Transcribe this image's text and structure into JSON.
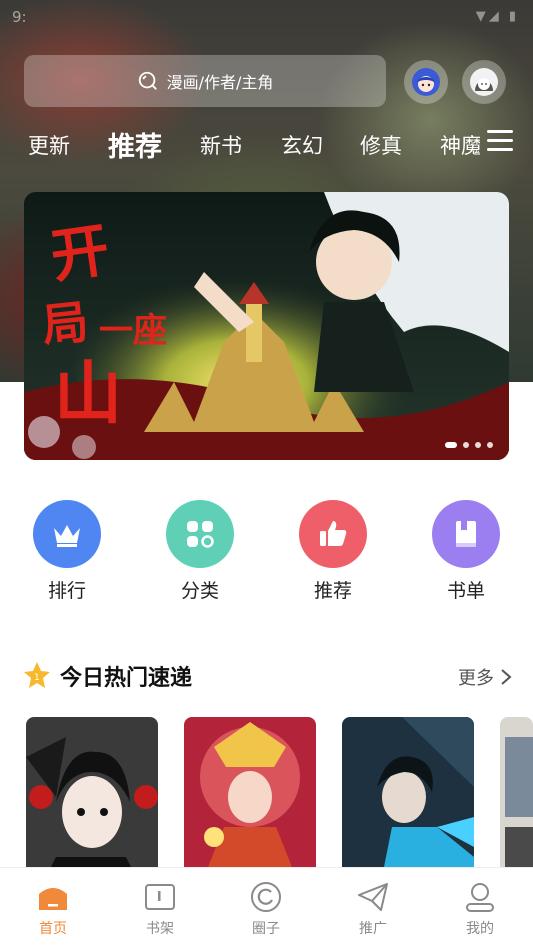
{
  "status": {
    "time": "9:",
    "icons": "▼◢ ▮"
  },
  "search": {
    "placeholder": "漫画/作者/主角"
  },
  "header": {
    "avatars": [
      "girl-avatar",
      "user-avatar"
    ]
  },
  "tabs": [
    {
      "label": "更新"
    },
    {
      "label": "推荐",
      "active": true
    },
    {
      "label": "新书"
    },
    {
      "label": "玄幻"
    },
    {
      "label": "修真"
    },
    {
      "label": "神魔"
    }
  ],
  "banner": {
    "title_art": "开局一座山",
    "page_count": 4,
    "current_page": 1
  },
  "quick_links": [
    {
      "label": "排行",
      "icon": "crown-icon",
      "color": "#4f86f2"
    },
    {
      "label": "分类",
      "icon": "category-icon",
      "color": "#5fcfb6"
    },
    {
      "label": "推荐",
      "icon": "thumbs-up-icon",
      "color": "#ef5f6a"
    },
    {
      "label": "书单",
      "icon": "book-icon",
      "color": "#9b7ef0"
    }
  ],
  "section": {
    "title": "今日热门速递",
    "more": "更多"
  },
  "bottom_nav": [
    {
      "label": "首页",
      "icon": "home-icon",
      "active": true
    },
    {
      "label": "书架",
      "icon": "bookshelf-icon"
    },
    {
      "label": "圈子",
      "icon": "circle-icon"
    },
    {
      "label": "推广",
      "icon": "send-icon"
    },
    {
      "label": "我的",
      "icon": "profile-icon"
    }
  ],
  "colors": {
    "accent": "#f08a3a",
    "text": "#222222"
  }
}
